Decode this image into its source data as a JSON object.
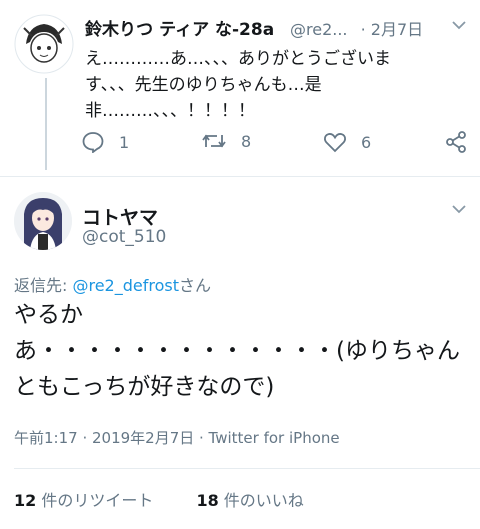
{
  "retweet_parent": {
    "name": "鈴木りつ ティア な-28a",
    "handle": "@re2...",
    "date": "· 2月7日",
    "text": "え…………あ…、、、ありがとうございます、、、先生のゆりちゃんも…是非………、、、！！！！",
    "reply_count": "1",
    "retweet_count": "8",
    "like_count": "6"
  },
  "tweet": {
    "name": "コトヤマ",
    "handle": "@cot_510",
    "reply_prefix": "返信先: ",
    "reply_mention": "@re2_defrost",
    "reply_suffix": "さん",
    "text": "やるか\nあ・・・・・・・・・・・・・(ゆりちゃんともこっちが好きなので)",
    "timestamp": "午前1:17 · 2019年2月7日 · Twitter for iPhone",
    "retweets_num": "12",
    "retweets_label": " 件のリツイート",
    "likes_num": "18",
    "likes_label": " 件のいいね"
  },
  "icons": [
    "chevron-down-icon",
    "reply-icon",
    "retweet-icon",
    "like-icon",
    "share-icon"
  ],
  "colors": {
    "muted": "#657786",
    "link": "#1b95e0",
    "divider": "#e6ecf0"
  }
}
